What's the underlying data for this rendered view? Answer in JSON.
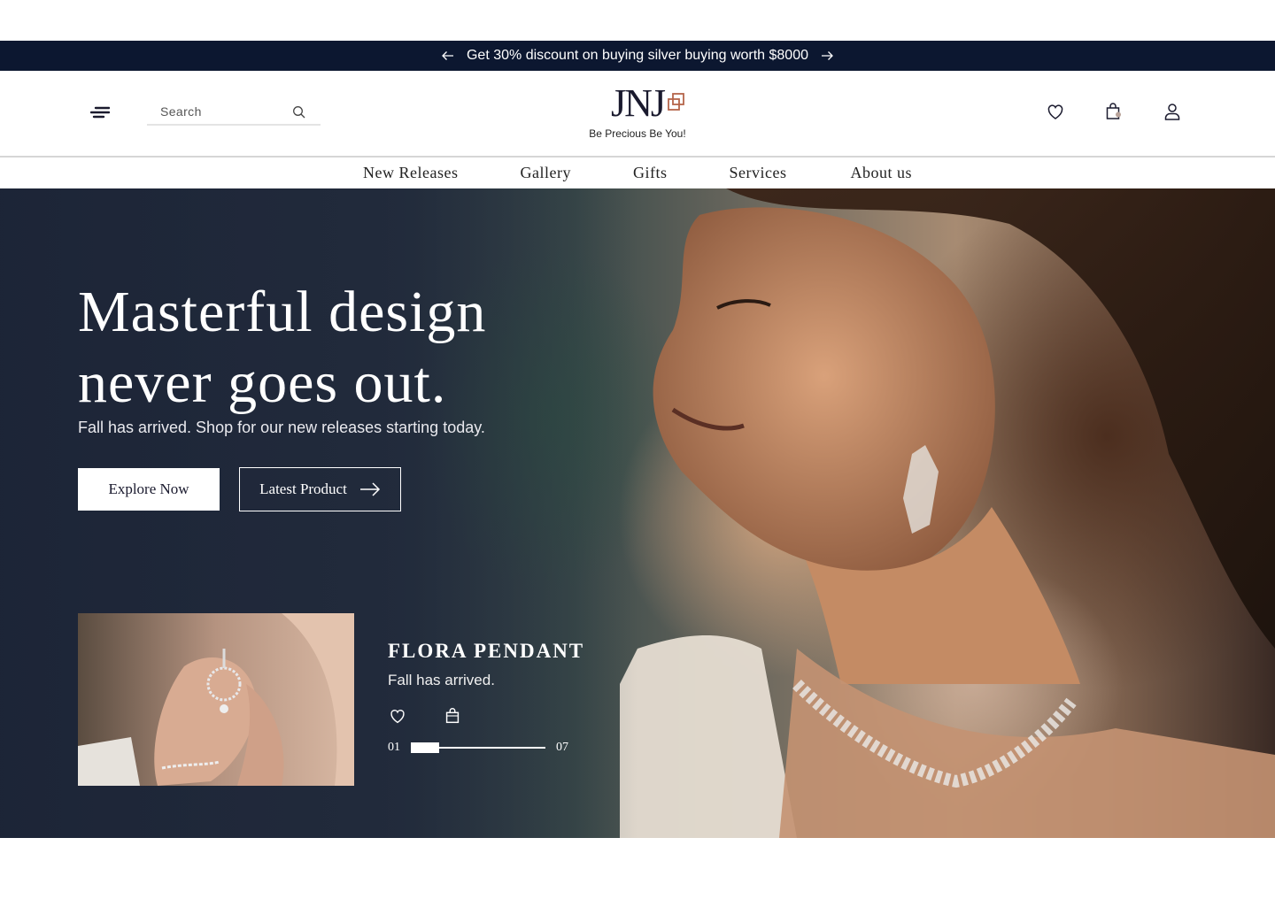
{
  "promo": {
    "text": "Get 30% discount on buying silver buying worth $8000",
    "prev_icon": "arrow-left-icon",
    "next_icon": "arrow-right-icon"
  },
  "header": {
    "search_placeholder": "Search",
    "logo_text": "JNJ",
    "tagline": "Be Precious Be You!",
    "icons": [
      "menu-icon",
      "search-icon",
      "heart-icon",
      "bag-icon",
      "user-icon"
    ]
  },
  "nav": {
    "items": [
      "New Releases",
      "Gallery",
      "Gifts",
      "Services",
      "About us"
    ]
  },
  "hero": {
    "title_line1": "Masterful design",
    "title_line2": "never goes out.",
    "subtitle": "Fall has arrived. Shop for our new releases starting today.",
    "explore_label": "Explore Now",
    "latest_label": "Latest Product"
  },
  "featured": {
    "name": "FLORA PENDANT",
    "description": "Fall has arrived.",
    "slide_current": "01",
    "slide_total": "07",
    "slider_progress": 0.21
  },
  "colors": {
    "promo_bg": "#0c1730",
    "accent_logo": "#b5654a",
    "text_dark": "#1a1a2e"
  }
}
